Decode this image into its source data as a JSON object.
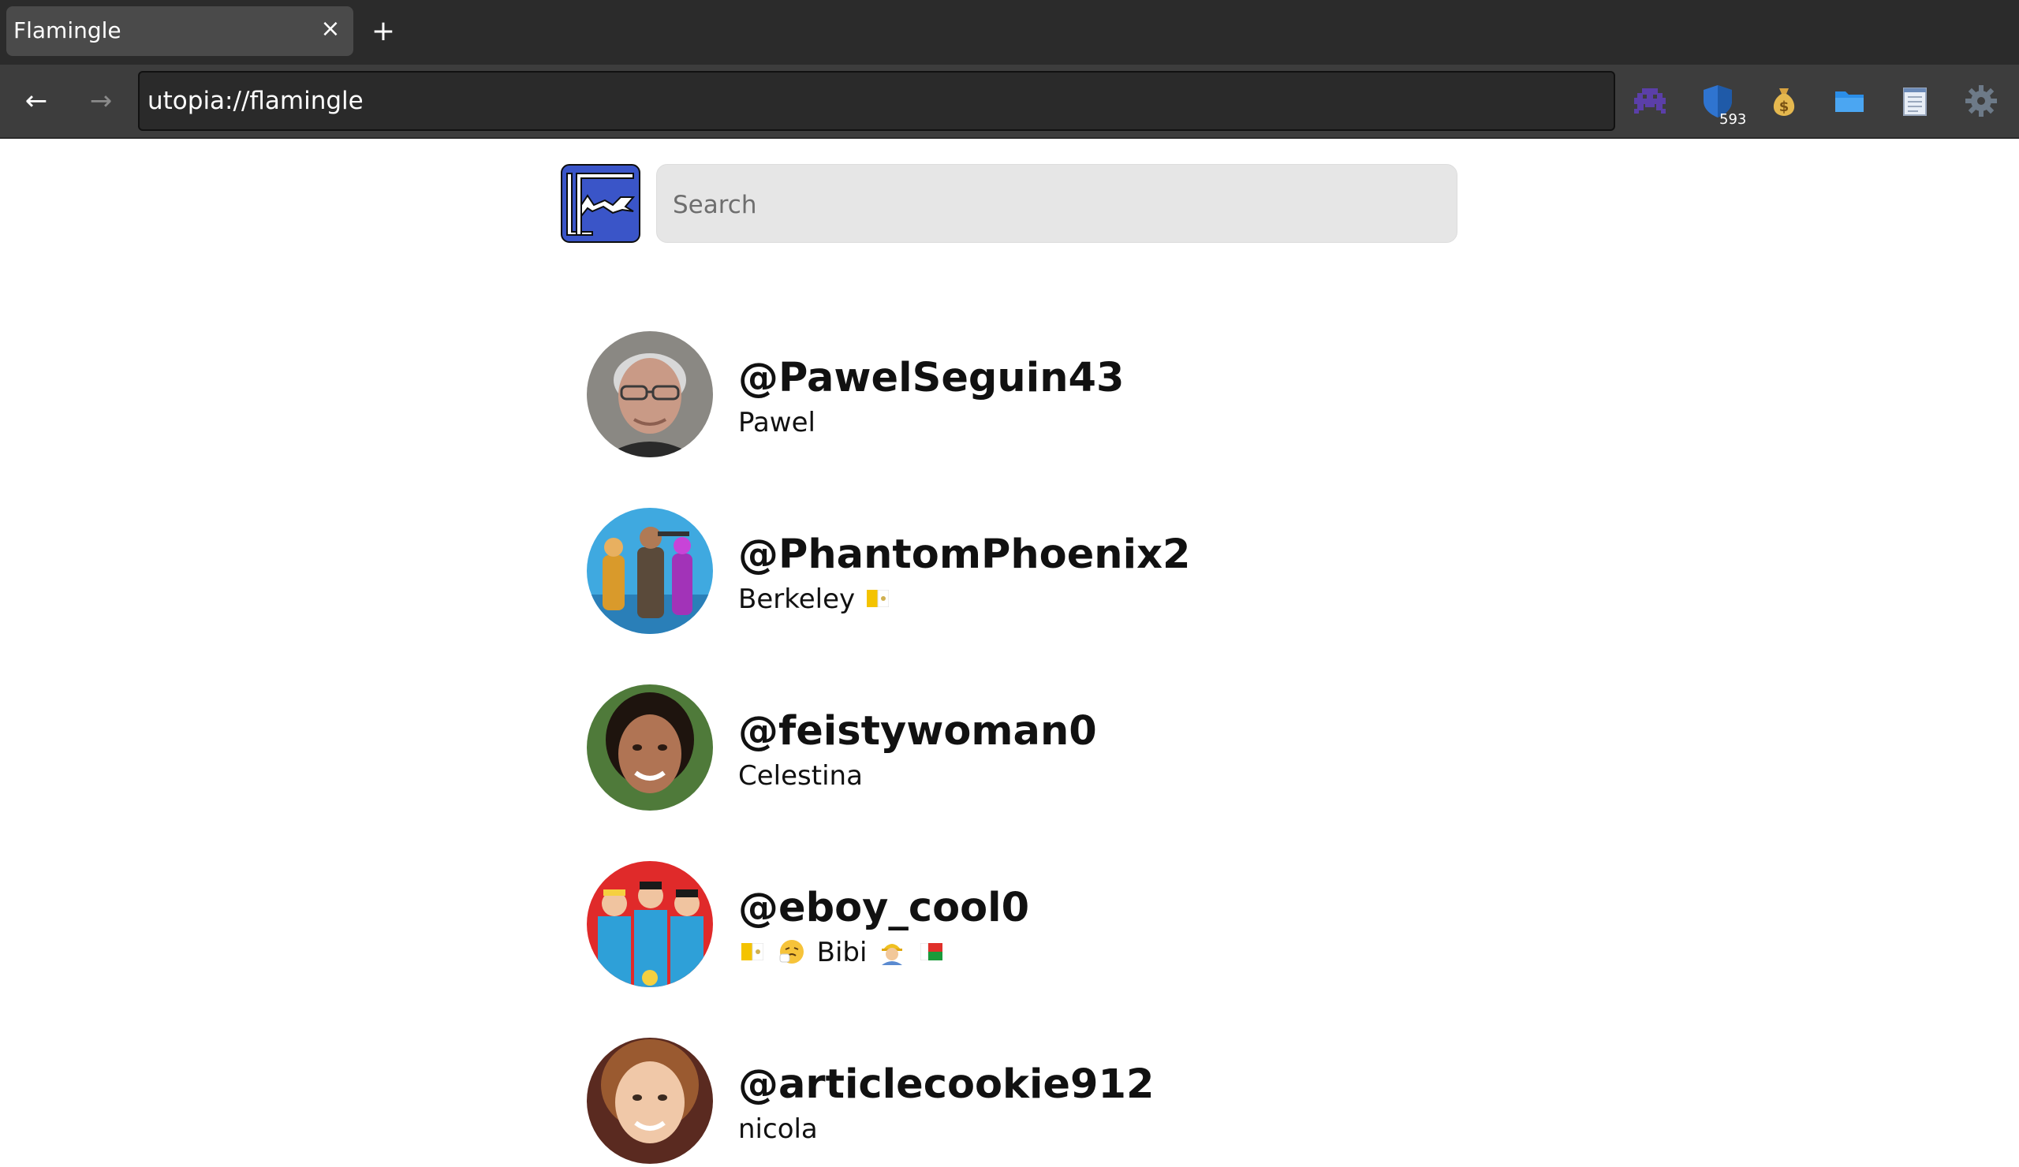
{
  "browser": {
    "tab_title": "Flamingle",
    "tab_close": "×",
    "new_tab": "+",
    "back": "←",
    "forward": "→",
    "url": "utopia://flamingle",
    "shield_badge": "593"
  },
  "search": {
    "placeholder": "Search"
  },
  "users": [
    {
      "handle": "@PawelSeguin43",
      "name": "Pawel"
    },
    {
      "handle": "@PhantomPhoenix2",
      "name": "Berkeley"
    },
    {
      "handle": "@feistywoman0",
      "name": "Celestina"
    },
    {
      "handle": "@eboy_cool0",
      "name": "Bibi"
    },
    {
      "handle": "@articlecookie912",
      "name": "nicola"
    }
  ],
  "colors": {
    "tab_bar": "#2b2b2b",
    "toolbar": "#3d3d3d",
    "search_bg": "#e6e6e6",
    "logo_blue": "#3a55c8"
  },
  "icons": [
    "invader-icon",
    "shield-icon",
    "money-bag-icon",
    "folder-icon",
    "notepad-icon",
    "gear-icon"
  ]
}
